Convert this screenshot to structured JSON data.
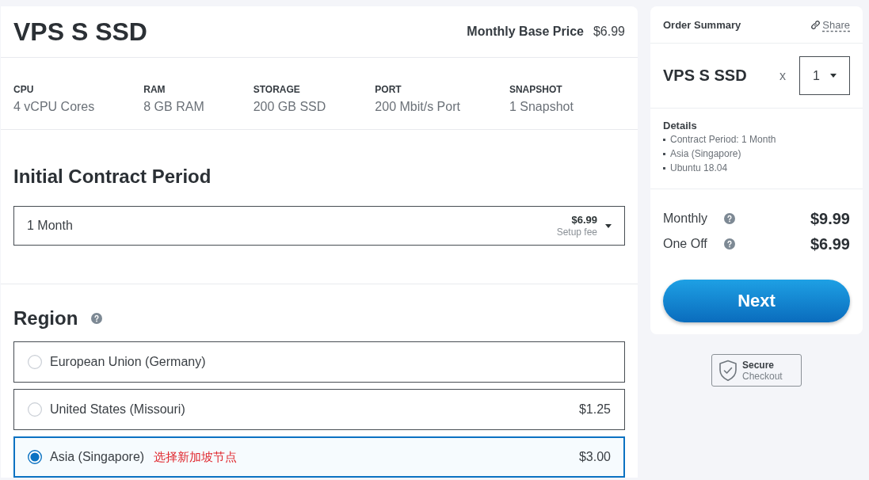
{
  "product": {
    "title": "VPS S SSD",
    "base_price_label": "Monthly Base Price",
    "base_price": "$6.99"
  },
  "specs": [
    {
      "label": "CPU",
      "value": "4 vCPU Cores"
    },
    {
      "label": "RAM",
      "value": "8 GB RAM"
    },
    {
      "label": "STORAGE",
      "value": "200 GB SSD"
    },
    {
      "label": "PORT",
      "value": "200 Mbit/s Port"
    },
    {
      "label": "SNAPSHOT",
      "value": "1 Snapshot"
    }
  ],
  "contract_period": {
    "heading": "Initial Contract Period",
    "select": {
      "value": "1 Month",
      "price": "$6.99",
      "price_note": "Setup fee"
    }
  },
  "region": {
    "heading": "Region",
    "options": [
      {
        "label": "European Union (Germany)",
        "selected": false
      },
      {
        "label": "United States (Missouri)",
        "price": "$1.25",
        "selected": false
      },
      {
        "label": "Asia (Singapore)",
        "annotation": "选择新加坡节点",
        "price": "$3.00",
        "selected": true
      }
    ]
  },
  "order_summary": {
    "title": "Order Summary",
    "share": "Share",
    "product": "VPS S SSD",
    "times": "x",
    "quantity": "1",
    "details_heading": "Details",
    "details": [
      "Contract Period: 1 Month",
      "Asia (Singapore)",
      "Ubuntu 18.04"
    ],
    "totals": [
      {
        "label": "Monthly",
        "amount": "$9.99"
      },
      {
        "label": "One Off",
        "amount": "$6.99"
      }
    ],
    "next_button": "Next"
  },
  "secure_badge": {
    "title": "Secure",
    "subtitle": "Checkout"
  }
}
